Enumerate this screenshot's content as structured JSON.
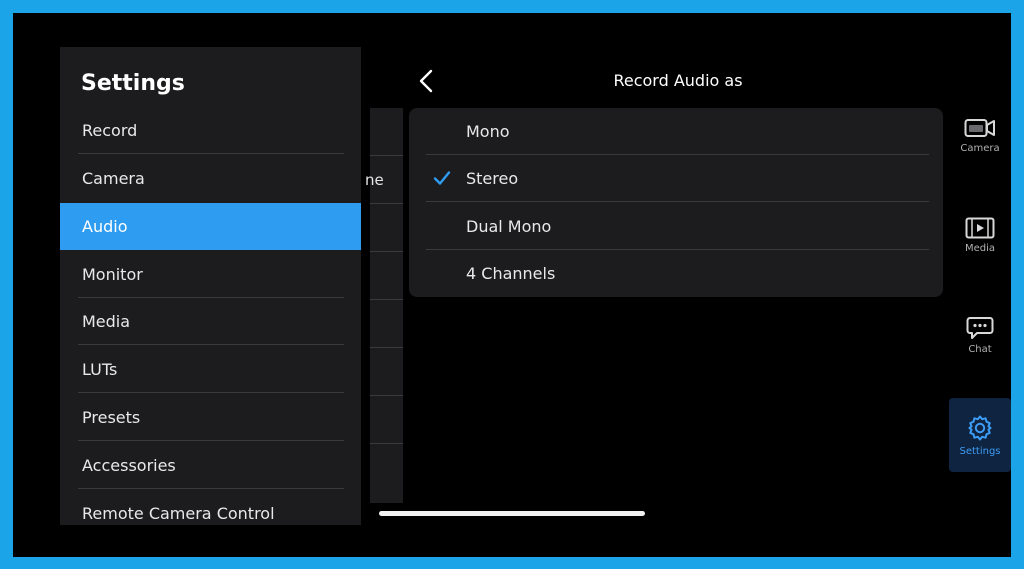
{
  "header": {
    "title": "Record Audio as"
  },
  "settings": {
    "title": "Settings",
    "items": [
      {
        "label": "Record",
        "active": false
      },
      {
        "label": "Camera",
        "active": false
      },
      {
        "label": "Audio",
        "active": true
      },
      {
        "label": "Monitor",
        "active": false
      },
      {
        "label": "Media",
        "active": false
      },
      {
        "label": "LUTs",
        "active": false
      },
      {
        "label": "Presets",
        "active": false
      },
      {
        "label": "Accessories",
        "active": false
      },
      {
        "label": "Remote Camera Control",
        "active": false
      }
    ]
  },
  "underlying": {
    "partial_text": "ne"
  },
  "options": {
    "selected": "Stereo",
    "items": [
      {
        "label": "Mono"
      },
      {
        "label": "Stereo"
      },
      {
        "label": "Dual Mono"
      },
      {
        "label": "4 Channels"
      }
    ]
  },
  "rail": {
    "items": [
      {
        "label": "Camera",
        "icon": "camera-icon"
      },
      {
        "label": "Media",
        "icon": "film-icon"
      },
      {
        "label": "Chat",
        "icon": "chat-icon"
      },
      {
        "label": "Settings",
        "icon": "gear-icon",
        "active": true
      }
    ]
  },
  "colors": {
    "accent": "#2e9cf0",
    "panel": "#1c1c1e",
    "frame": "#1ca4e8"
  }
}
